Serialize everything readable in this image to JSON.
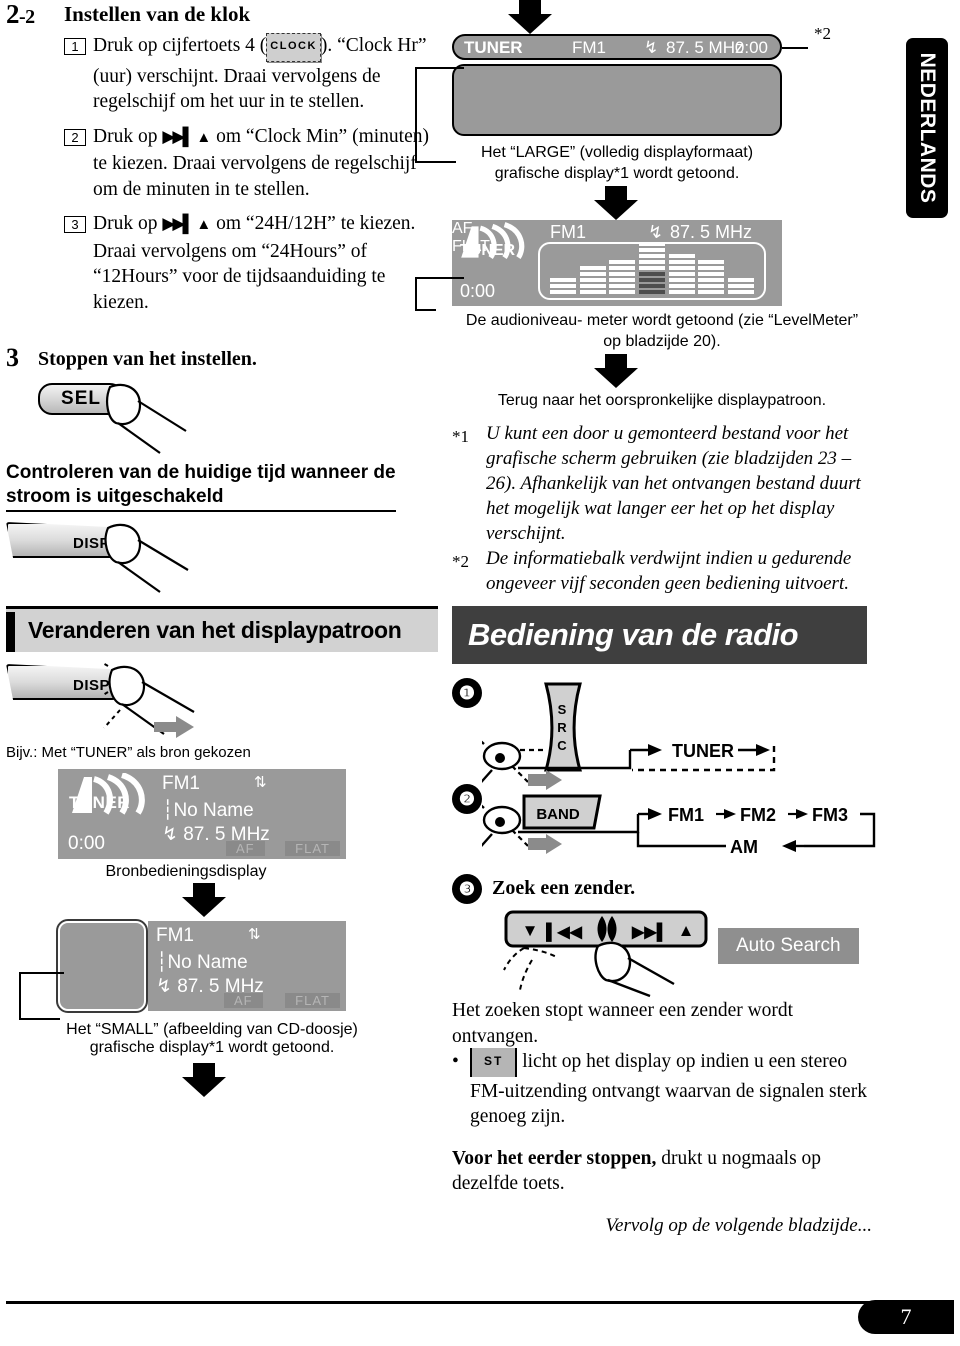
{
  "page": {
    "number": "7",
    "language_tab": "NEDERLANDS",
    "continued": "Vervolg op de volgende bladzijde..."
  },
  "left": {
    "section_number_main": "2",
    "section_number_sub": "-2",
    "section_title": "Instellen van de klok",
    "steps": [
      {
        "num": "1",
        "text_before": "Druk op cijfertoets 4 (",
        "chip": "CLOCK",
        "text_after": "). “Clock Hr” (uur) verschijnt. Draai vervolgens de regelschijf om het uur in te stellen."
      },
      {
        "num": "2",
        "text_before": "Druk op ",
        "text_after": " om “Clock Min” (minuten) te kiezen. Draai vervolgens de regelschijf om de minuten in te stellen."
      },
      {
        "num": "3",
        "text_before": "Druk op ",
        "text_after": " om “24H/12H” te kiezen. Draai vervolgens om “24Hours” of “12Hours” voor de tijdsaanduiding te kiezen."
      }
    ],
    "step3": {
      "num": "3",
      "label": "Stoppen van het instellen."
    },
    "sel_key": "SEL",
    "check_time_heading_line1": "Controleren van de huidige tijd wanneer de",
    "check_time_heading_line2": "stroom is uitgeschakeld",
    "disp_key": "DISP",
    "banner_heading": "Veranderen van het displaypatroon",
    "bijv": "Bijv.: Met “TUNER” als bron gekozen",
    "lcd_source": {
      "source": "TUNER",
      "band": "FM1",
      "name": "No  Name",
      "freq": "87. 5  MHz",
      "clock": "0:00",
      "af": "AF",
      "flat": "FLAT"
    },
    "caption_source": "Bronbedieningsdisplay",
    "lcd_small": {
      "band": "FM1",
      "name": "No  Name",
      "freq": "87. 5  MHz",
      "af": "AF",
      "flat": "FLAT"
    },
    "caption_small_line1": "Het “SMALL” (afbeelding van CD-doosje)",
    "caption_small_line2": "grafische display*1 wordt getoond."
  },
  "right": {
    "lcd_bar": {
      "source": "TUNER",
      "band": "FM1",
      "freq": "87. 5 MHz",
      "clock": "0:00",
      "note_mark": "*2"
    },
    "caption_large_line1": "Het “LARGE” (volledig displayformaat)",
    "caption_large_line2": "grafische display*1 wordt getoond.",
    "lcd_meter": {
      "source": "TUNER",
      "band": "FM1",
      "freq": "87. 5  MHz",
      "clock": "0:00",
      "af": "AF",
      "flat": "FLAT"
    },
    "caption_meter_line1": "De audioniveau- meter wordt getoond (zie “LevelMeter”",
    "caption_meter_line2": "op bladzijde 20).",
    "caption_return": "Terug naar het oorspronkelijke displaypatroon.",
    "footnotes": [
      {
        "mark": "*1",
        "text": "U kunt een door u gemonteerd bestand voor het grafische scherm gebruiken (zie bladzijden 23 – 26). Afhankelijk van het ontvangen bestand duurt het mogelijk wat langer eer het op het display verschijnt."
      },
      {
        "mark": "*2",
        "text": "De informatiebalk verdwijnt indien u gedurende ongeveer vijf seconden geen bediening uitvoert."
      }
    ],
    "radio_banner": "Bediening van de radio",
    "step1": {
      "num": "❶",
      "key": "SRC",
      "flow": "TUNER"
    },
    "step2": {
      "num": "❷",
      "key": "BAND",
      "flow": [
        "FM1",
        "FM2",
        "FM3",
        "AM"
      ]
    },
    "step3": {
      "num": "❸",
      "label": "Zoek een zender.",
      "badge": "Auto Search"
    },
    "search_body": "Het zoeken stopt wanneer een zender wordt ontvangen.",
    "bullet_chip": "ST",
    "bullet_text": " licht op het display op indien u een stereo FM-uitzending ontvangt waarvan de signalen sterk genoeg zijn.",
    "stop_bold": "Voor het eerder stoppen,",
    "stop_rest": " drukt u nogmaals op dezelfde toets."
  },
  "colors": {
    "lcd_bg": "#9a9a9a",
    "banner_grey": "#d2d2d2",
    "dark_banner": "#3f3f3f",
    "badge_grey": "#8f8f8f"
  }
}
